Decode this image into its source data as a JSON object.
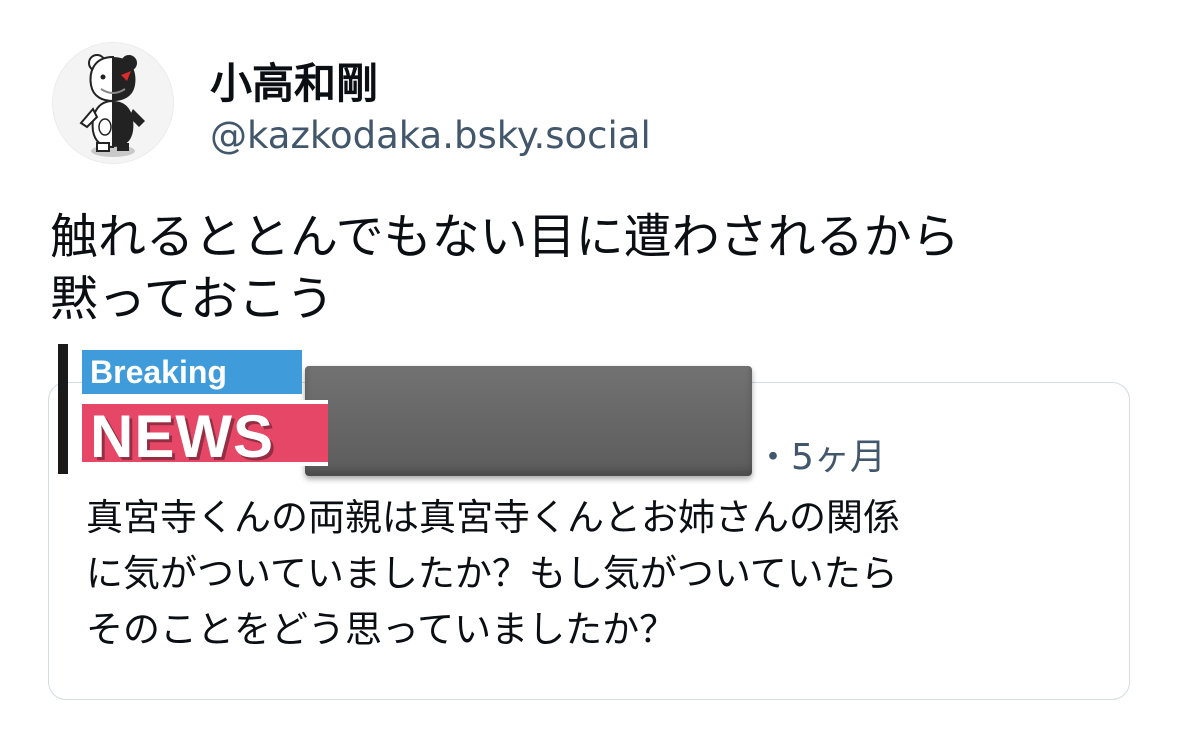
{
  "author": {
    "display_name": "小高和剛",
    "handle": "@kazkodaka.bsky.social",
    "avatar_icon": "monokuma-avatar-icon"
  },
  "post": {
    "text_lines": [
      "触れるととんでもない目に遭わされるから",
      "黙っておこう"
    ]
  },
  "quote": {
    "time": "・5ヶ月",
    "text_lines": [
      "真宮寺くんの両親は真宮寺くんとお姉さんの関係",
      "に気がついていましたか？もし気がついていたら",
      "そのことをどう思っていましたか？"
    ]
  },
  "sticker": {
    "breaking": "Breaking",
    "news": "NEWS",
    "colors": {
      "breaking_bg": "#3f9bd9",
      "news_bg": "#e64767"
    }
  },
  "colors": {
    "text": "#0b0f14",
    "muted": "#42576c",
    "border": "#d4dbe2",
    "redaction": "#666666"
  }
}
